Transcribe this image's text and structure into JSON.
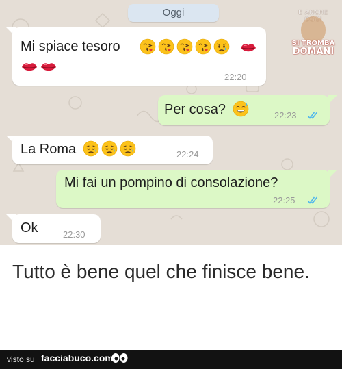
{
  "chat": {
    "date_label": "Oggi",
    "watermark": {
      "top_text": "E ANCHE OGGI",
      "line1": "SI TROMBA",
      "line2": "DOMANI"
    },
    "messages": [
      {
        "direction": "incoming",
        "text": "Mi spiace tesoro",
        "emojis": [
          "face-blowing-kiss",
          "face-blowing-kiss",
          "face-blowing-kiss",
          "face-blowing-kiss",
          "crying-face",
          "kiss-mark",
          "kiss-mark",
          "kiss-mark"
        ],
        "time": "22:20"
      },
      {
        "direction": "outgoing",
        "text": "Per cosa?",
        "emojis": [
          "grinning-sweat-face"
        ],
        "time": "22:23",
        "status": "read"
      },
      {
        "direction": "incoming",
        "text": "La  Roma",
        "emojis": [
          "sad-face",
          "sad-face",
          "sad-face"
        ],
        "time": "22:24"
      },
      {
        "direction": "outgoing",
        "text": "Mi fai un pompino di consolazione?",
        "emojis": [],
        "time": "22:25",
        "status": "read"
      },
      {
        "direction": "incoming",
        "text": "Ok",
        "emojis": [],
        "time": "22:30"
      }
    ]
  },
  "caption": "Tutto è bene quel che finisce bene.",
  "footer": {
    "prefix": "visto su",
    "site": "facciabuco.com",
    "logo_icon": "eyes-icon"
  },
  "colors": {
    "chat_background": "#e5ded6",
    "incoming_bubble": "#ffffff",
    "outgoing_bubble": "#dcf8c6",
    "read_ticks": "#4fb6ec",
    "kiss_mark": "#d81b3c",
    "emoji_yellow": "#fcc21b"
  }
}
